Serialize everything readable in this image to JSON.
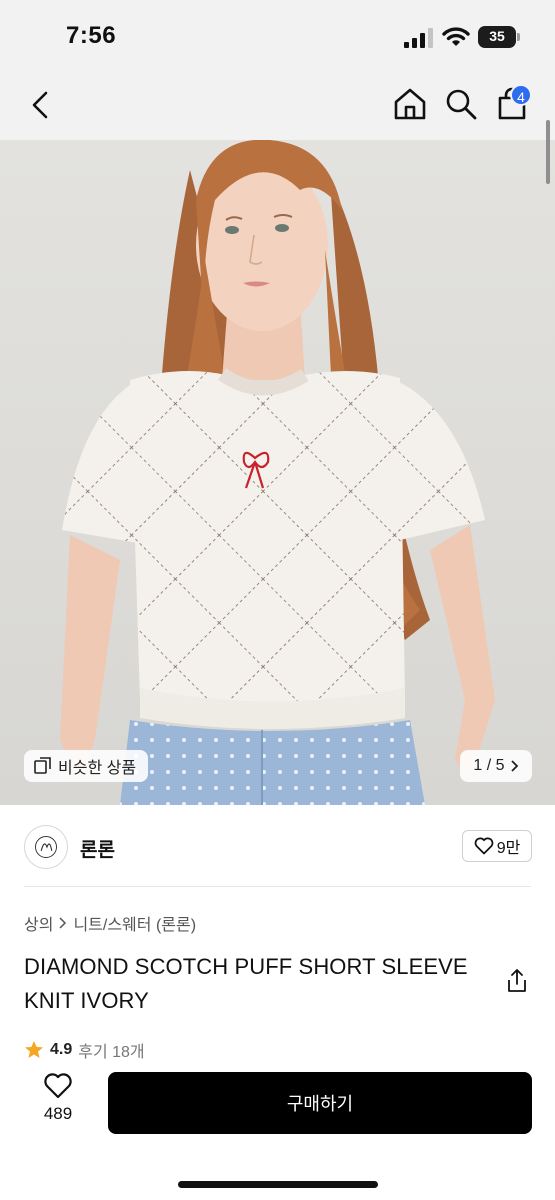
{
  "status_bar": {
    "time": "7:56",
    "battery": "35"
  },
  "nav": {
    "cart_count": "4",
    "icons": [
      "back-icon",
      "home-icon",
      "search-icon",
      "cart-icon"
    ]
  },
  "gallery": {
    "similar_label": "비슷한 상품",
    "counter": "1 / 5",
    "colors": {
      "shirt": "#f4f1ec",
      "hair": "#b9713f",
      "jeans": "#9bb6d6",
      "bow": "#c8232c"
    }
  },
  "brand": {
    "name": "론론",
    "likes": "9만"
  },
  "product": {
    "breadcrumb": [
      "상의",
      "니트/스웨터 (론론)"
    ],
    "title": "DIAMOND SCOTCH PUFF SHORT SLEEVE KNIT IVORY",
    "rating": "4.9",
    "reviews": "후기 18개"
  },
  "bottom": {
    "wish_count": "489",
    "buy_label": "구매하기",
    "buy_color": "#000000",
    "badge_color": "#2d6cf0",
    "star_color": "#f5a623"
  }
}
